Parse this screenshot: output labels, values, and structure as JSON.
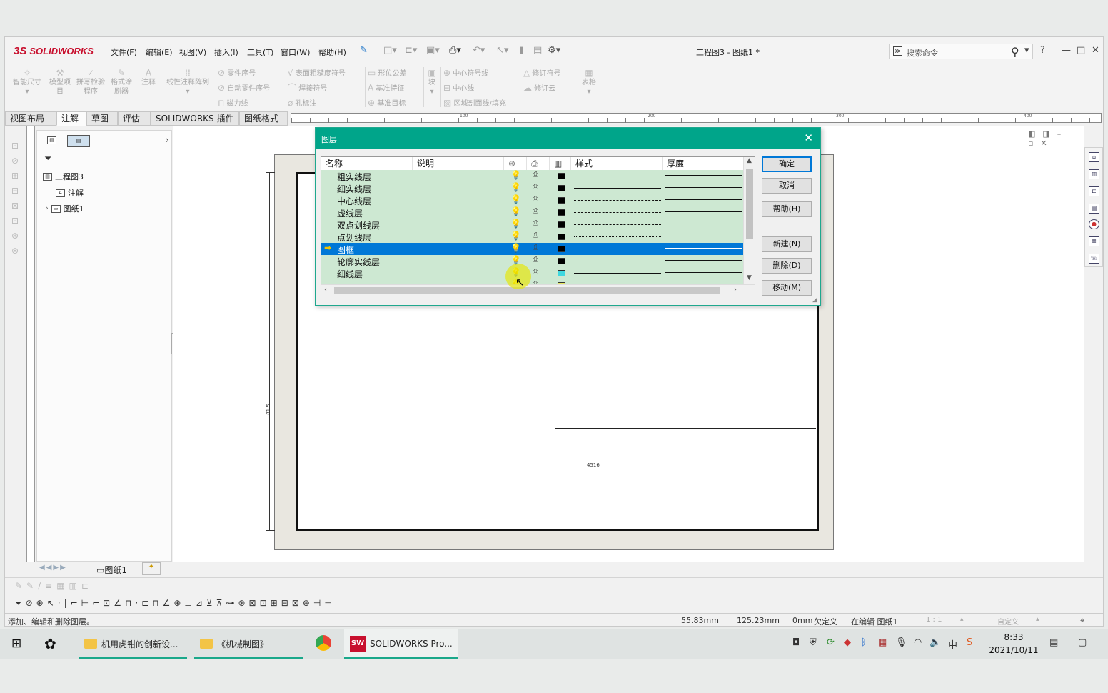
{
  "app": {
    "brand": "SOLIDWORKS",
    "brand_mark": "3S",
    "window_title": "工程图3 - 图纸1 *",
    "search_placeholder": "搜索命令",
    "menu": [
      "文件(F)",
      "编辑(E)",
      "视图(V)",
      "插入(I)",
      "工具(T)",
      "窗口(W)",
      "帮助(H)"
    ],
    "help_symbol": "?"
  },
  "ribbon": {
    "big_buttons": [
      {
        "label": "智能尺寸",
        "icon": "smart-dimension-icon"
      },
      {
        "label": "模型项目",
        "icon": "model-items-icon"
      },
      {
        "label": "拼写检验程序",
        "icon": "spell-check-icon"
      },
      {
        "label": "格式涂刷器",
        "icon": "format-painter-icon"
      },
      {
        "label": "注释",
        "icon": "note-icon"
      },
      {
        "label": "线性注释阵列",
        "icon": "linear-pattern-icon"
      }
    ],
    "col1": [
      "零件序号",
      "自动零件序号",
      "磁力线"
    ],
    "col2": [
      "表面粗糙度符号",
      "焊接符号",
      "孔标注"
    ],
    "col3": [
      "形位公差",
      "基准特征",
      "基准目标"
    ],
    "block": "块",
    "col4": [
      "中心符号线",
      "中心线",
      "区域剖面线/填充"
    ],
    "col5": [
      "修订符号",
      "修订云"
    ],
    "table": "表格"
  },
  "tabs": [
    "视图布局",
    "注解",
    "草图",
    "评估",
    "SOLIDWORKS 插件",
    "图纸格式"
  ],
  "active_tab": "注解",
  "ruler_labels": [
    "100",
    "200",
    "300",
    "400"
  ],
  "tree": {
    "root": "工程图3",
    "items": [
      "注解",
      "图纸1"
    ]
  },
  "sheet_tab": "图纸1",
  "drawing": {
    "dim_text_1": "4516",
    "dim_text_2": "81.5"
  },
  "dialog": {
    "title": "图层",
    "columns": [
      "名称",
      "说明",
      "样式",
      "厚度"
    ],
    "layers": [
      {
        "name": "粗实线层",
        "color": "#000000",
        "style": "solid",
        "thick": "thick"
      },
      {
        "name": "细实线层",
        "color": "#000000",
        "style": "solid",
        "thick": "thin"
      },
      {
        "name": "中心线层",
        "color": "#000000",
        "style": "center",
        "thick": "thin"
      },
      {
        "name": "虚线层",
        "color": "#000000",
        "style": "dashed",
        "thick": "thin"
      },
      {
        "name": "双点划线层",
        "color": "#000000",
        "style": "phantom",
        "thick": "thin"
      },
      {
        "name": "点划线层",
        "color": "#000000",
        "style": "dashdot",
        "thick": "thin"
      },
      {
        "name": "图框",
        "color": "#000000",
        "style": "solid",
        "thick": "thin",
        "selected": true
      },
      {
        "name": "轮廓实线层",
        "color": "#000000",
        "style": "solid",
        "thick": "thick"
      },
      {
        "name": "细线层",
        "color": "#3fd8e0",
        "style": "solid",
        "thick": "thin"
      },
      {
        "name": "",
        "color": "#e8e860",
        "style": "solid",
        "thick": "thin"
      }
    ],
    "buttons": {
      "ok": "确定",
      "cancel": "取消",
      "help": "帮助(H)",
      "new": "新建(N)",
      "delete": "删除(D)",
      "move": "移动(M)"
    }
  },
  "status": {
    "message": "添加、编辑和删除图层。",
    "x": "55.83mm",
    "y": "125.23mm",
    "z": "0mm",
    "def": "欠定义",
    "editing": "在编辑 图纸1",
    "scale": "1 : 1",
    "custom": "自定义"
  },
  "taskbar": {
    "apps": [
      "机用虎钳的创新设...",
      "《机械制图》",
      "SOLIDWORKS Pro..."
    ],
    "time": "8:33",
    "date": "2021/10/11",
    "ime": "中"
  },
  "colors": {
    "accent": "#00a58a",
    "selection": "#0078d7",
    "layer_row": "#cde8d2"
  }
}
